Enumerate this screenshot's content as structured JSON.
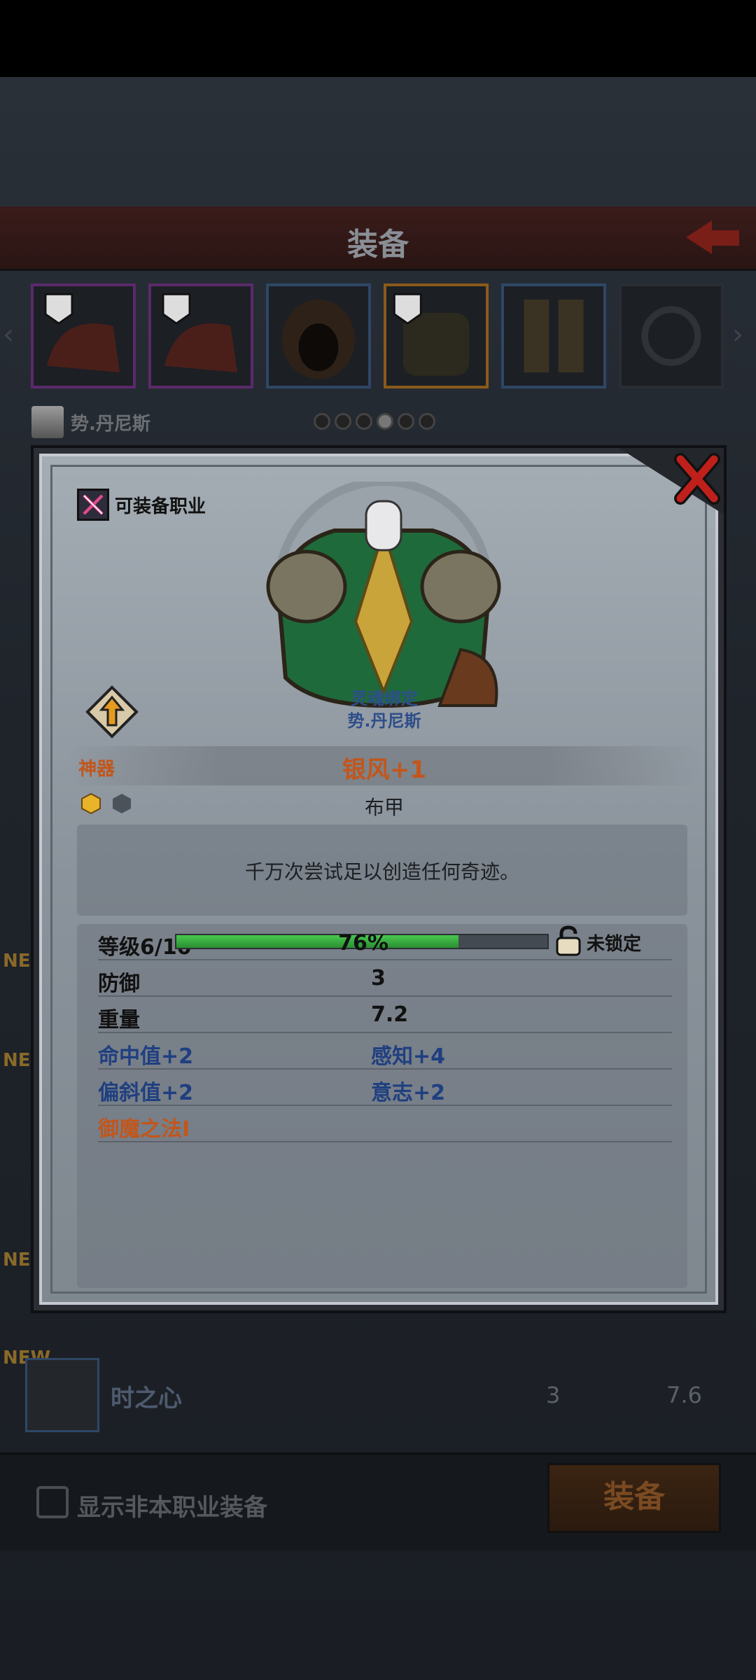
{
  "screen": {
    "title": "装备",
    "hero_name": "势.丹尼斯",
    "page_dots": {
      "count": 6,
      "active": 3
    },
    "new_tag": "NEW",
    "list_item": {
      "name": "时之心",
      "defense": "3",
      "weight": "7.6"
    },
    "show_other_class_label": "显示非本职业装备",
    "equip_button": "装备"
  },
  "modal": {
    "class_label": "可装备职业",
    "soulbound_label": "灵魂绑定",
    "bound_hero": "势.丹尼斯",
    "rarity": "神器",
    "item_name": "银风+1",
    "item_type": "布甲",
    "description": "千万次尝试足以创造任何奇迹。",
    "level_label": "等级6/10",
    "progress": {
      "percent_label": "76%",
      "value": 0.76
    },
    "lock_label": "未锁定",
    "stats": {
      "defense_label": "防御",
      "defense_value": "3",
      "weight_label": "重量",
      "weight_value": "7.2",
      "hit": "命中值+2",
      "perception": "感知+4",
      "dodge": "偏斜值+2",
      "will": "意志+2",
      "skill": "御魔之法I"
    }
  },
  "colors": {
    "rarity": "#c2561c",
    "bonus": "#1f3f80",
    "progress": "#3fb847"
  }
}
